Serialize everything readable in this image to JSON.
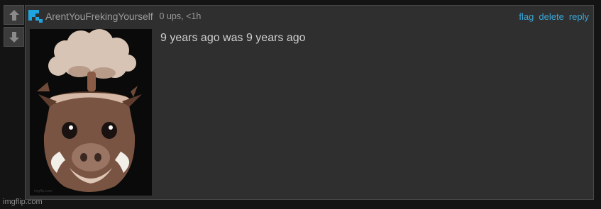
{
  "vote": {
    "up_icon": "up-arrow-icon",
    "down_icon": "down-arrow-icon"
  },
  "comment": {
    "user_icon": "pixel-staircase-icon",
    "username": "ArentYouFrekingYourself",
    "meta": "0 ups, <1h",
    "actions": {
      "flag": "flag",
      "delete": "delete",
      "reply": "reply"
    },
    "text": "9 years ago was 9 years ago",
    "image_description": "exploding-head boar animoji"
  },
  "watermark": "imgflip.com",
  "colors": {
    "background": "#141414",
    "panel": "#2f2f2f",
    "link": "#3aa7d8",
    "user_icon": "#1ea5df"
  }
}
